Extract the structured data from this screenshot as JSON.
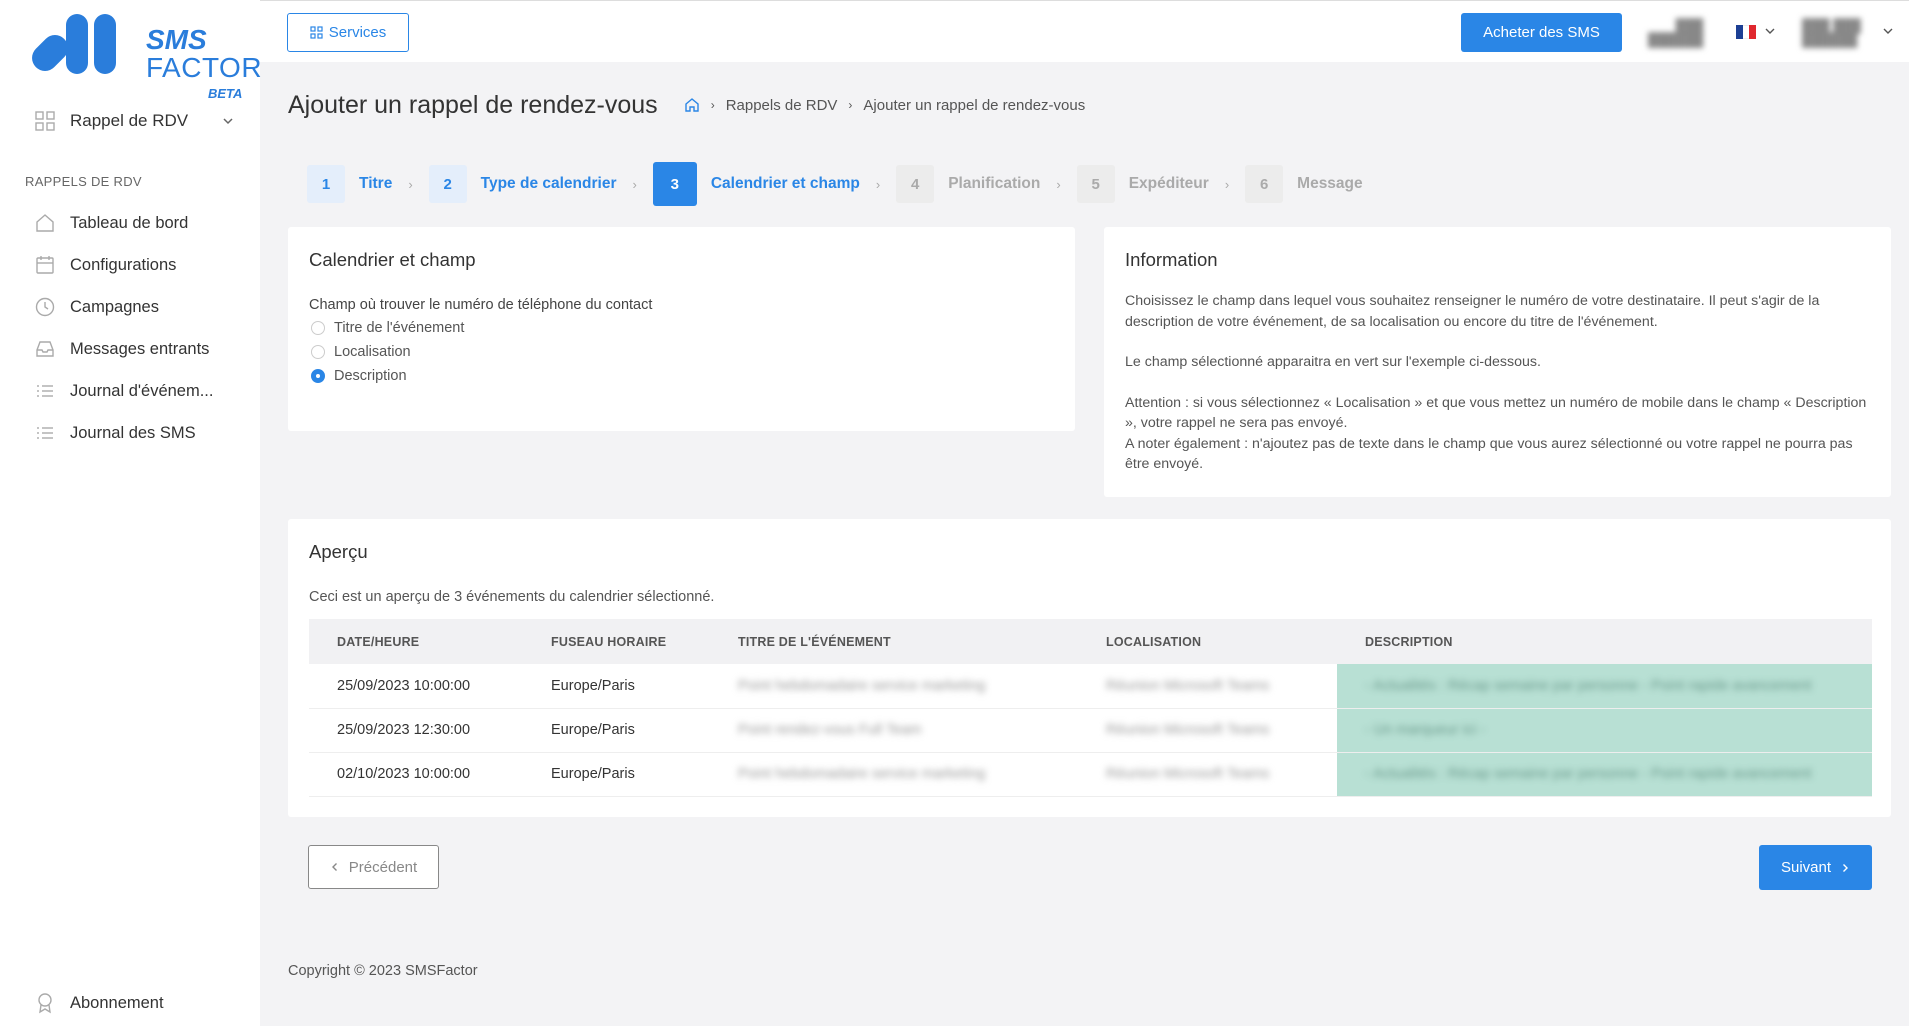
{
  "logo": {
    "line1": "SMS",
    "line2": "FACTOR",
    "badge": "BETA",
    "color": "#2a7ddb"
  },
  "sidebar": {
    "dropdown": {
      "label": "Rappel de RDV",
      "icon": "grid-icon"
    },
    "section_title": "RAPPELS DE RDV",
    "items": [
      {
        "label": "Tableau de bord",
        "icon": "home-icon"
      },
      {
        "label": "Configurations",
        "icon": "calendar-icon"
      },
      {
        "label": "Campagnes",
        "icon": "clock-icon"
      },
      {
        "label": "Messages entrants",
        "icon": "inbox-icon"
      },
      {
        "label": "Journal d'événem...",
        "icon": "list-icon"
      },
      {
        "label": "Journal des SMS",
        "icon": "list-icon"
      }
    ],
    "bottom_item": {
      "label": "Abonnement",
      "icon": "badge-icon"
    }
  },
  "topbar": {
    "services_label": "Services",
    "buy_label": "Acheter des SMS",
    "account_line1": "███",
    "account_line2": "██████",
    "user_line1": "███ ███",
    "user_line2": "██████",
    "language": "FR"
  },
  "page": {
    "title": "Ajouter un rappel de rendez-vous",
    "breadcrumb": [
      "Rappels de RDV",
      "Ajouter un rappel de rendez-vous"
    ]
  },
  "steps": [
    {
      "num": "1",
      "label": "Titre",
      "state": "done"
    },
    {
      "num": "2",
      "label": "Type de calendrier",
      "state": "done"
    },
    {
      "num": "3",
      "label": "Calendrier et champ",
      "state": "active"
    },
    {
      "num": "4",
      "label": "Planification",
      "state": "todo"
    },
    {
      "num": "5",
      "label": "Expéditeur",
      "state": "todo"
    },
    {
      "num": "6",
      "label": "Message",
      "state": "todo"
    }
  ],
  "calendar_card": {
    "title": "Calendrier et champ",
    "field_label": "Champ où trouver le numéro de téléphone du contact",
    "options": [
      {
        "label": "Titre de l'événement",
        "selected": false
      },
      {
        "label": "Localisation",
        "selected": false
      },
      {
        "label": "Description",
        "selected": true
      }
    ]
  },
  "info_card": {
    "title": "Information",
    "p1": "Choisissez le champ dans lequel vous souhaitez renseigner le numéro de votre destinataire. Il peut s'agir de la description de votre événement, de sa localisation ou encore du titre de l'événement.",
    "p2": "Le champ sélectionné apparaitra en vert sur l'exemple ci-dessous.",
    "p3a": "Attention : si vous sélectionnez « Localisation » et que vous mettez un numéro de mobile dans le champ « Description », votre rappel ne sera pas envoyé.",
    "p3b": "A noter également : n'ajoutez pas de texte dans le champ que vous aurez sélectionné ou votre rappel ne pourra pas être envoyé."
  },
  "preview": {
    "title": "Aperçu",
    "subtitle": "Ceci est un aperçu de 3 événements du calendrier sélectionné.",
    "columns": [
      "DATE/HEURE",
      "FUSEAU HORAIRE",
      "TITRE DE L'ÉVÉNEMENT",
      "LOCALISATION",
      "DESCRIPTION"
    ],
    "rows": [
      {
        "date": "25/09/2023 10:00:00",
        "tz": "Europe/Paris",
        "title": "Point hebdomadaire service marketing",
        "location": "Réunion Microsoft Teams",
        "description": "- Actualités : Récap semaine par personne - Point rapide avancement"
      },
      {
        "date": "25/09/2023 12:30:00",
        "tz": "Europe/Paris",
        "title": "Point rendez-vous Full Team",
        "location": "Réunion Microsoft Teams",
        "description": "- Un marqueur ici -"
      },
      {
        "date": "02/10/2023 10:00:00",
        "tz": "Europe/Paris",
        "title": "Point hebdomadaire service marketing",
        "location": "Réunion Microsoft Teams",
        "description": "- Actualités : Récap semaine par personne - Point rapide avancement"
      }
    ],
    "highlight_color": "#b8e0d4"
  },
  "nav": {
    "prev_label": "Précédent",
    "next_label": "Suivant"
  },
  "footer": {
    "copyright": "Copyright © 2023 SMSFactor"
  },
  "colors": {
    "primary": "#2a86e6",
    "background": "#f3f3f5"
  }
}
